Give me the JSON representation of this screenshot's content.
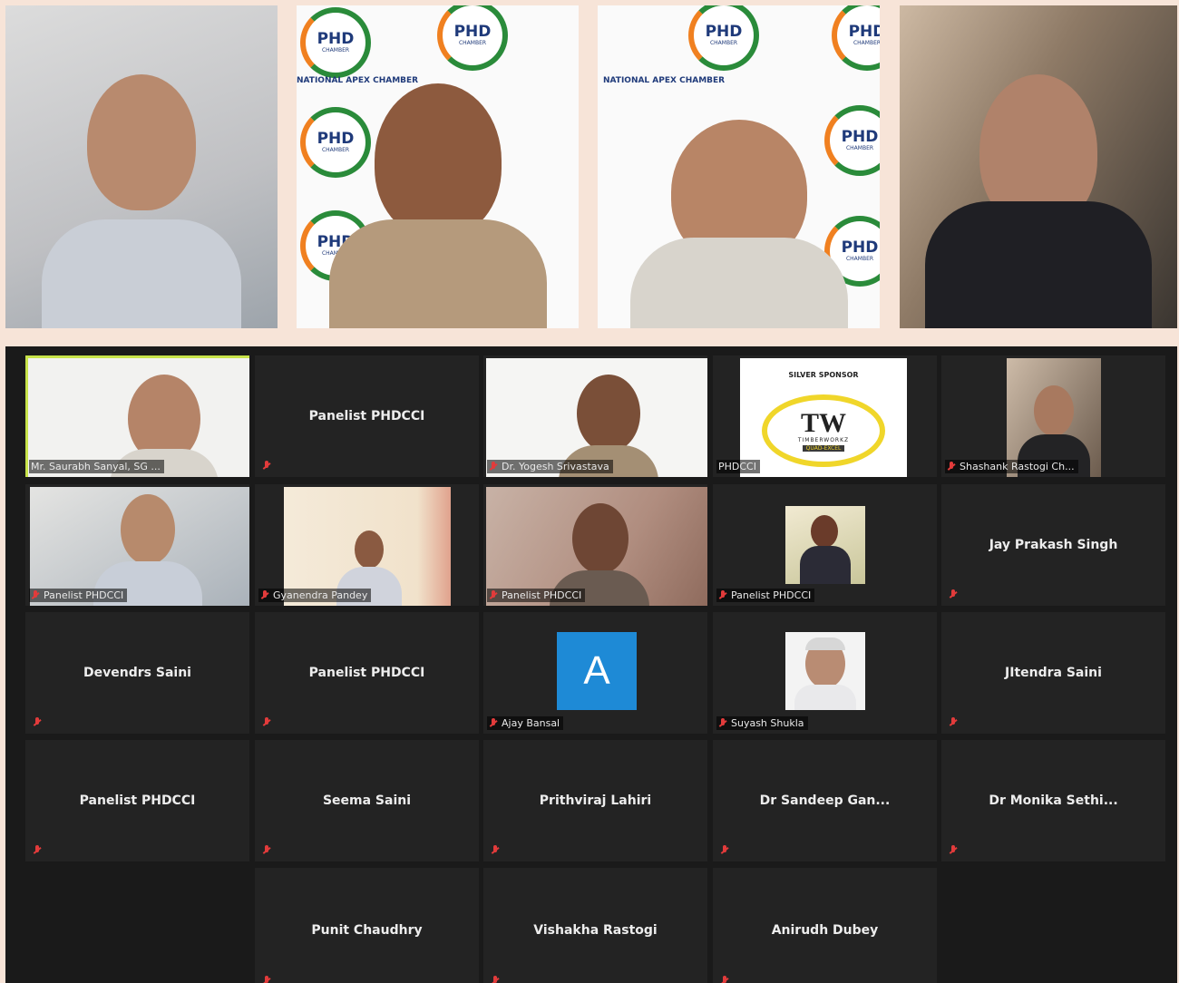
{
  "featured": {
    "logo_text": "PHD",
    "logo_sub": "CHAMBER",
    "band_text": "NATIONAL APEX CHAMBER"
  },
  "gallery": {
    "tiles": [
      {
        "name": "Mr. Saurabh Sanyal, SG ...",
        "video": true,
        "active": true
      },
      {
        "name": "Panelist PHDCCI",
        "video": false
      },
      {
        "name": "Dr. Yogesh Srivastava",
        "video": true
      },
      {
        "name": "PHDCCI",
        "video": true
      },
      {
        "name": "Shashank Rastogi Ch...",
        "video": true
      },
      {
        "name": "Panelist PHDCCI",
        "video": true
      },
      {
        "name": "Gyanendra Pandey",
        "video": true
      },
      {
        "name": "Panelist PHDCCI",
        "video": true
      },
      {
        "name": "Panelist PHDCCI",
        "video": true
      },
      {
        "name": "Jay Prakash Singh",
        "video": false
      },
      {
        "name": "Devendrs Saini",
        "video": false
      },
      {
        "name": "Panelist PHDCCI",
        "video": false
      },
      {
        "name": "Ajay Bansal",
        "video": false,
        "avatar_letter": "A"
      },
      {
        "name": "Suyash Shukla",
        "video": true
      },
      {
        "name": "JItendra Saini",
        "video": false
      },
      {
        "name": "Panelist PHDCCI",
        "video": false
      },
      {
        "name": "Seema Saini",
        "video": false
      },
      {
        "name": "Prithviraj Lahiri",
        "video": false
      },
      {
        "name": "Dr Sandeep Gan...",
        "video": false
      },
      {
        "name": "Dr Monika Sethi...",
        "video": false
      },
      {
        "name": "Punit Chaudhry",
        "video": false
      },
      {
        "name": "Vishakha Rastogi",
        "video": false
      },
      {
        "name": "Anirudh Dubey",
        "video": false
      }
    ],
    "sponsor": {
      "title": "SILVER SPONSOR",
      "brand": "TW",
      "brand_sub": "TIMBERWORKZ",
      "tag": "QUAD-EXCEL"
    }
  },
  "colors": {
    "gallery_bg": "#1a1a1a",
    "tile_bg": "#232323",
    "active_border": "#c8e34a",
    "muted_mic": "#e23b3b",
    "avatar_blue": "#1e8ad6"
  }
}
